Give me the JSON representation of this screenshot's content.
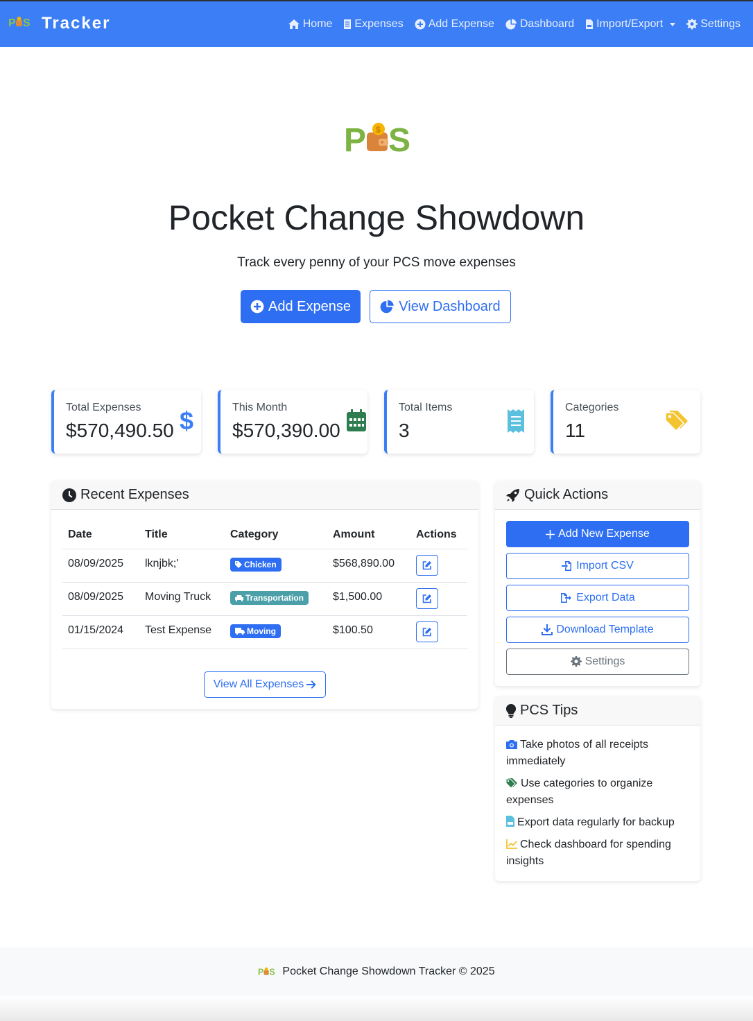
{
  "brand": {
    "logo_text": "PCS",
    "name": "Tracker"
  },
  "nav": {
    "home": "Home",
    "expenses": "Expenses",
    "add_expense": "Add Expense",
    "dashboard": "Dashboard",
    "import_export": "Import/Export",
    "settings": "Settings"
  },
  "hero": {
    "title": "Pocket Change Showdown",
    "subtitle": "Track every penny of your PCS move expenses",
    "add_button": "Add Expense",
    "dashboard_button": "View Dashboard"
  },
  "stats": [
    {
      "label": "Total Expenses",
      "value": "$570,490.50",
      "icon": "dollar-icon",
      "color": "#3b7ef6"
    },
    {
      "label": "This Month",
      "value": "$570,390.00",
      "icon": "calendar-icon",
      "color": "#2e7d4f"
    },
    {
      "label": "Total Items",
      "value": "3",
      "icon": "receipt-icon",
      "color": "#5bc0de"
    },
    {
      "label": "Categories",
      "value": "11",
      "icon": "tags-icon",
      "color": "#f4c430"
    }
  ],
  "recent": {
    "title": "Recent Expenses",
    "columns": [
      "Date",
      "Title",
      "Category",
      "Amount",
      "Actions"
    ],
    "rows": [
      {
        "date": "08/09/2025",
        "title": "lknjbk;'",
        "category": "Chicken",
        "category_color": "#2d6ef2",
        "amount": "$568,890.00"
      },
      {
        "date": "08/09/2025",
        "title": "Moving Truck",
        "category": "Transportation",
        "category_color": "#4a9fa8",
        "amount": "$1,500.00"
      },
      {
        "date": "01/15/2024",
        "title": "Test Expense",
        "category": "Moving",
        "category_color": "#2d6ef2",
        "amount": "$100.50"
      }
    ],
    "view_all": "View All Expenses"
  },
  "quick_actions": {
    "title": "Quick Actions",
    "add_new": "Add New Expense",
    "import_csv": "Import CSV",
    "export_data": "Export Data",
    "download_template": "Download Template",
    "settings": "Settings"
  },
  "tips": {
    "title": "PCS Tips",
    "items": [
      {
        "text": "Take photos of all receipts immediately",
        "icon": "camera-icon",
        "color": "#2d6ef2"
      },
      {
        "text": "Use categories to organize expenses",
        "icon": "tags-icon",
        "color": "#2e7d4f"
      },
      {
        "text": "Export data regularly for backup",
        "icon": "csv-file-icon",
        "color": "#5bc0de"
      },
      {
        "text": "Check dashboard for spending insights",
        "icon": "chart-line-icon",
        "color": "#f4c430"
      }
    ]
  },
  "footer": {
    "logo_text": "PCS",
    "text": "Pocket Change Showdown Tracker © 2025"
  }
}
